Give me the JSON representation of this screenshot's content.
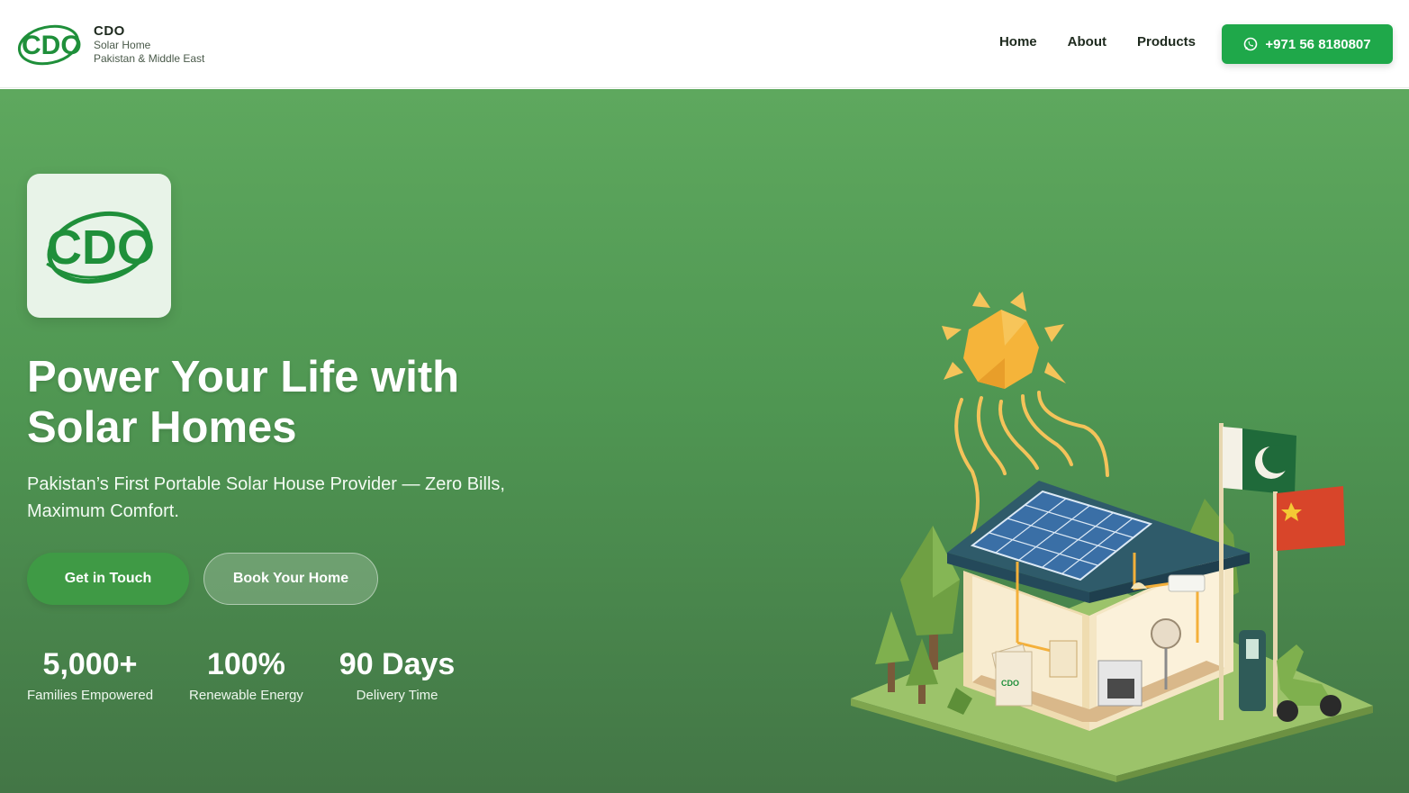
{
  "header": {
    "brand_name": "CDO",
    "brand_line1": "Solar Home",
    "brand_line2": "Pakistan & Middle East",
    "logo_text": "CDO",
    "nav": [
      {
        "label": "Home"
      },
      {
        "label": "About"
      },
      {
        "label": "Products"
      }
    ],
    "phone_label": "+971 56 8180807"
  },
  "hero": {
    "logo_text": "CDO",
    "headline_line1": "Power Your Life with",
    "headline_line2": "Solar Homes",
    "subline": "Pakistan’s First Portable Solar House Provider — Zero Bills, Maximum Comfort.",
    "primary_cta": "Get in Touch",
    "secondary_cta": "Book Your Home",
    "stats": [
      {
        "value": "5,000+",
        "label": "Families Empowered"
      },
      {
        "value": "100%",
        "label": "Renewable Energy"
      },
      {
        "value": "90 Days",
        "label": "Delivery Time"
      }
    ],
    "illustration_brand": "CDO"
  },
  "colors": {
    "brand_green": "#1fa84a",
    "logo_green": "#1f8f3a",
    "hero_top": "#5ea85e",
    "hero_bottom": "#437646",
    "primary_button": "#3f9a45",
    "sun": "#f5b43a"
  },
  "icons": {
    "phone_button": "whatsapp-icon"
  }
}
